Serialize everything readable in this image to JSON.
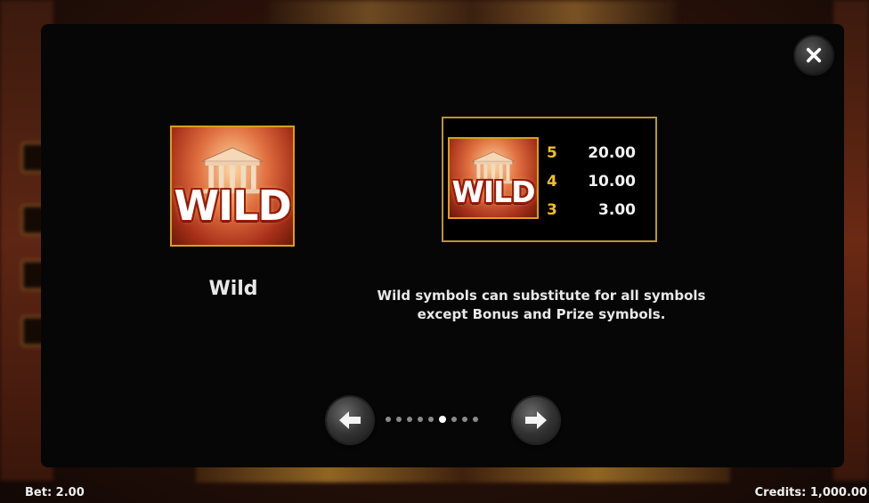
{
  "dialog": {
    "symbol_name": "Wild",
    "wild_tile_label": "WILD",
    "description_line1": "Wild symbols can substitute for all symbols",
    "description_line2": "except Bonus and Prize symbols.",
    "close_icon": "close-icon",
    "paytable": [
      {
        "count": "5",
        "value": "20.00"
      },
      {
        "count": "4",
        "value": "10.00"
      },
      {
        "count": "3",
        "value": "3.00"
      }
    ],
    "pagination": {
      "total_pages": 9,
      "current_page": 6
    },
    "prev_icon": "arrow-left-icon",
    "next_icon": "arrow-right-icon"
  },
  "footer": {
    "bet": "Bet: 2.00",
    "credits": "Credits: 1,000.00"
  },
  "colors": {
    "gold": "#f0c020",
    "panel": "#060606",
    "paytable_border": "#b8962e"
  }
}
